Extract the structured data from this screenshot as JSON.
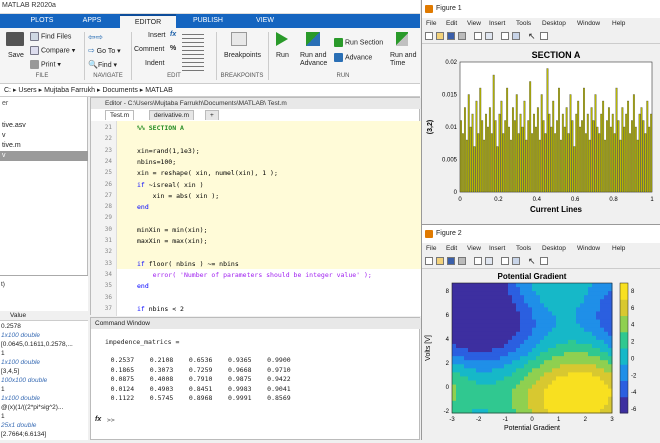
{
  "app": {
    "title": "MATLAB R2020a"
  },
  "tabs": [
    "PLOTS",
    "APPS",
    "EDITOR",
    "PUBLISH",
    "VIEW"
  ],
  "ribbon": {
    "save": "Save",
    "find_files": "Find Files",
    "compare": "Compare ▾",
    "print": "Print ▾",
    "go_to": "Go To ▾",
    "find": "Find ▾",
    "insert": "Insert",
    "comment": "Comment",
    "indent": "Indent",
    "fx": "fx",
    "pct": "%",
    "breakpoints": "Breakpoints",
    "run": "Run",
    "run_advance": "Run and\nAdvance",
    "run_section": "Run Section",
    "advance": "Advance",
    "run_time": "Run and\nTime",
    "groups": {
      "file": "FILE",
      "navigate": "NAVIGATE",
      "edit": "EDIT",
      "breakpoints": "BREAKPOINTS",
      "run": "RUN"
    }
  },
  "address": {
    "path": "C: ▸ Users ▸ Mujtaba Farrukh ▸ Documents ▸ MATLAB"
  },
  "files": [
    "tive.asv",
    "v",
    "tive.m",
    "v"
  ],
  "file_header": "er",
  "workspace": {
    "header_left": "t)",
    "col": "Value",
    "rows": [
      {
        "v": "0.2578",
        "d": false
      },
      {
        "v": "1x100 double",
        "d": true
      },
      {
        "v": "[0.0645,0.1611,0.2578,...",
        "d": false
      },
      {
        "v": "1",
        "d": false
      },
      {
        "v": "1x100 double",
        "d": true
      },
      {
        "v": "[3,4,5]",
        "d": false
      },
      {
        "v": "100x100 double",
        "d": true
      },
      {
        "v": "1",
        "d": false
      },
      {
        "v": "1x100 double",
        "d": true
      },
      {
        "v": "@(x)(1/((2*pi*sig^2)...",
        "d": false
      },
      {
        "v": "1",
        "d": false
      },
      {
        "v": "25x1 double",
        "d": true
      },
      {
        "v": "[2.7664;6.6134]",
        "d": false
      }
    ]
  },
  "editor": {
    "title": "Editor - C:\\Users\\Mujtaba Farrukh\\Documents\\MATLAB\\ Test.m",
    "tabs": [
      "Test.m",
      "derivative.m",
      "+"
    ],
    "lines": [
      {
        "n": "21",
        "t": "%% SECTION A",
        "c": "#228b22",
        "b": true
      },
      {
        "n": "22",
        "t": "",
        "c": "#000"
      },
      {
        "n": "23",
        "t": "xin=rand(1,1e3);",
        "c": "#000"
      },
      {
        "n": "24",
        "t": "nbins=100;",
        "c": "#000"
      },
      {
        "n": "25",
        "t": "xin = reshape( xin, numel(xin), 1 );",
        "c": "#000"
      },
      {
        "n": "26",
        "t": "if ~isreal( xin )",
        "c": "#000"
      },
      {
        "n": "27",
        "t": "    xin = abs( xin );",
        "c": "#000"
      },
      {
        "n": "28",
        "t": "end",
        "c": "#0000ff"
      },
      {
        "n": "29",
        "t": "",
        "c": "#000"
      },
      {
        "n": "30",
        "t": "minXin = min(xin);",
        "c": "#000"
      },
      {
        "n": "31",
        "t": "maxXin = max(xin);",
        "c": "#000"
      },
      {
        "n": "32",
        "t": "",
        "c": "#000"
      },
      {
        "n": "33",
        "t": "if floor( nbins ) ~= nbins",
        "c": "#000"
      },
      {
        "n": "34",
        "t": "    error( 'Number of parameters should be integer value' );",
        "c": "#a020f0"
      },
      {
        "n": "35",
        "t": "end",
        "c": "#0000ff"
      },
      {
        "n": "36",
        "t": "",
        "c": "#000"
      },
      {
        "n": "37",
        "t": "if nbins < 2",
        "c": "#000"
      }
    ]
  },
  "command": {
    "title": "Command Window",
    "var": "impedence_matrics =",
    "rows": [
      "    0.2537    0.2108    0.6536    0.9365    0.9900",
      "    0.1865    0.3073    0.7259    0.9668    0.9710",
      "    0.0875    0.4008    0.7910    0.9875    0.9422",
      "    0.0124    0.4903    0.8451    0.9983    0.9041",
      "    0.1122    0.5745    0.8968    0.9991    0.8569"
    ],
    "prompt": ">>"
  },
  "fig1": {
    "title": "Figure 1",
    "menu": [
      "File",
      "Edit",
      "View",
      "Insert",
      "Tools",
      "Desktop",
      "Window",
      "Help"
    ]
  },
  "fig2": {
    "title": "Figure 2",
    "menu": [
      "File",
      "Edit",
      "View",
      "Insert",
      "Tools",
      "Desktop",
      "Window",
      "Help"
    ]
  },
  "chart_data": [
    {
      "type": "bar",
      "title": "SECTION A",
      "xlabel": "Current Lines",
      "ylabel": "(3,2)",
      "xlim": [
        0,
        1
      ],
      "ylim": [
        0,
        0.02
      ],
      "xticks": [
        "0",
        "0.2",
        "0.4",
        "0.6",
        "0.8",
        "1"
      ],
      "yticks": [
        "0",
        "0.005",
        "0.01",
        "0.015",
        "0.02"
      ],
      "color": "#b8b800",
      "values": [
        0.011,
        0.009,
        0.013,
        0.008,
        0.015,
        0.01,
        0.012,
        0.007,
        0.014,
        0.009,
        0.016,
        0.011,
        0.008,
        0.012,
        0.01,
        0.013,
        0.009,
        0.018,
        0.011,
        0.007,
        0.012,
        0.014,
        0.009,
        0.011,
        0.016,
        0.01,
        0.008,
        0.013,
        0.011,
        0.015,
        0.009,
        0.012,
        0.01,
        0.014,
        0.008,
        0.011,
        0.017,
        0.009,
        0.012,
        0.01,
        0.013,
        0.008,
        0.015,
        0.011,
        0.009,
        0.019,
        0.012,
        0.01,
        0.014,
        0.009,
        0.011,
        0.016,
        0.008,
        0.012,
        0.01,
        0.013,
        0.009,
        0.015,
        0.011,
        0.007,
        0.012,
        0.014,
        0.01,
        0.011,
        0.016,
        0.009,
        0.012,
        0.008,
        0.013,
        0.011,
        0.015,
        0.01,
        0.009,
        0.012,
        0.014,
        0.008,
        0.011,
        0.013,
        0.01,
        0.012,
        0.009,
        0.016,
        0.011,
        0.008,
        0.013,
        0.01,
        0.012,
        0.014,
        0.009,
        0.011,
        0.015,
        0.01,
        0.008,
        0.012,
        0.013,
        0.011,
        0.009,
        0.014,
        0.01,
        0.012
      ]
    },
    {
      "type": "heatmap",
      "title": "Potential Gradient",
      "xlabel": "Potential Gradient",
      "ylabel": "Volts [V]",
      "xlim": [
        -3,
        3
      ],
      "ylim": [
        -3,
        9
      ],
      "xticks": [
        "-3",
        "-2",
        "-1",
        "0",
        "1",
        "2",
        "3"
      ],
      "yticks": [
        "8",
        "6",
        "4",
        "2",
        "0",
        "-2"
      ],
      "colorbar": [
        "8",
        "6",
        "4",
        "2",
        "0",
        "-2",
        "-4",
        "-6"
      ]
    }
  ]
}
